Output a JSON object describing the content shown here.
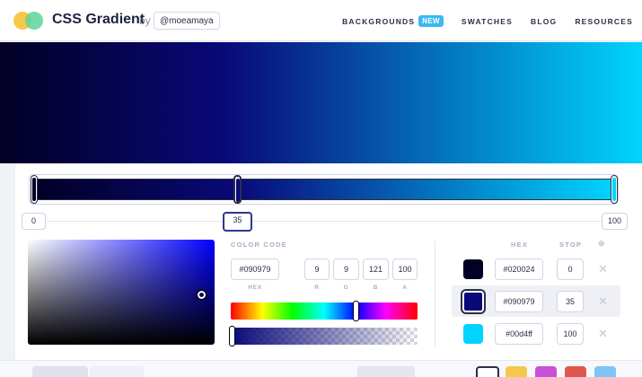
{
  "header": {
    "brand": "CSS Gradient",
    "by": "by",
    "author": "@moeamaya",
    "nav": [
      {
        "label": "BACKGROUNDS",
        "badge": "NEW"
      },
      {
        "label": "SWATCHES"
      },
      {
        "label": "BLOG"
      },
      {
        "label": "RESOURCES"
      }
    ]
  },
  "gradient": {
    "stops_labels": [
      "0",
      "35",
      "100"
    ],
    "colors": [
      "#020024",
      "#090979",
      "#00d4ff"
    ]
  },
  "picker": {
    "section_label": "COLOR CODE",
    "hex": "#090979",
    "r": "9",
    "g": "9",
    "b": "121",
    "a": "100",
    "labels": {
      "hex": "HEX",
      "r": "R",
      "g": "G",
      "b": "B",
      "a": "A"
    }
  },
  "stops_table": {
    "headers": {
      "hex": "HEX",
      "stop": "STOP"
    },
    "rows": [
      {
        "hex": "#020024",
        "stop": "0"
      },
      {
        "hex": "#090979",
        "stop": "35"
      },
      {
        "hex": "#00d4ff",
        "stop": "100"
      }
    ],
    "remove_glyph": "✕",
    "add_glyph": "⊕"
  }
}
